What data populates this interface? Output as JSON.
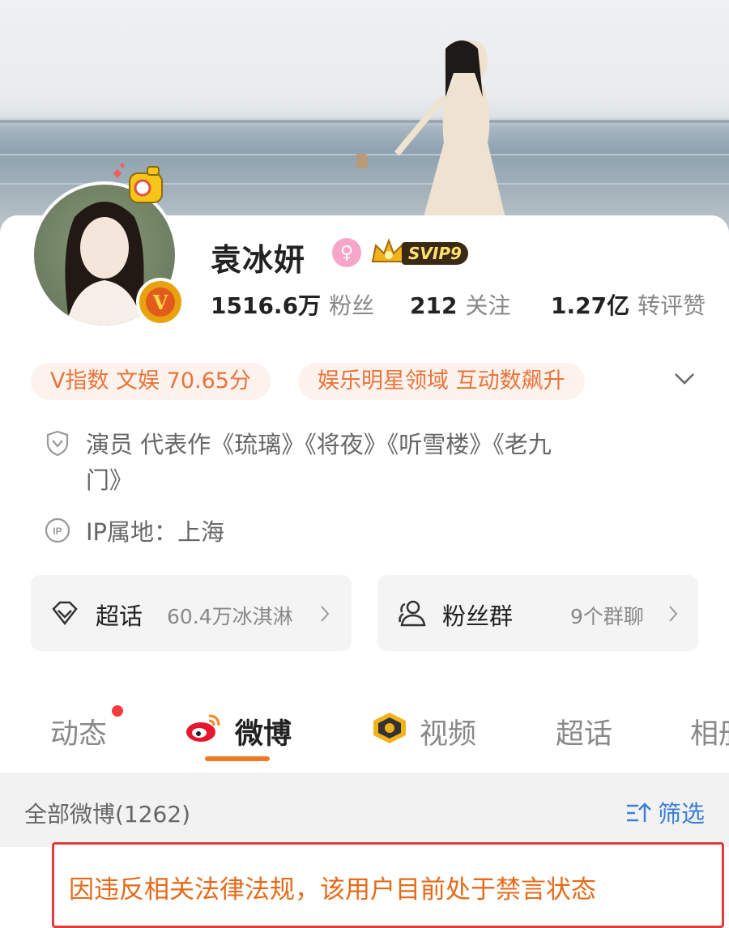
{
  "profile": {
    "name": "袁冰妍",
    "gender_icon": "female-icon",
    "vip_badge": "SVIP9",
    "verify_badge": "V"
  },
  "stats": {
    "fans_value": "1516.6万",
    "fans_label": "粉丝",
    "following_value": "212",
    "following_label": "关注",
    "likes_value": "1.27亿",
    "likes_label": "转评赞"
  },
  "pills": {
    "v_index": "V指数 文娱 70.65分",
    "field": "娱乐明星领域 互动数飙升"
  },
  "info": {
    "bio_line1": "演员 代表作《琉璃》《将夜》《听雪楼》《老九",
    "bio_line2": "门》",
    "ip": "IP属地：上海"
  },
  "boxes": {
    "topic_label": "超话",
    "topic_value": "60.4万冰淇淋",
    "group_label": "粉丝群",
    "group_value": "9个群聊"
  },
  "tabs": {
    "dynamics": "动态",
    "weibo": "微博",
    "video": "视频",
    "super_topic": "超话",
    "album": "相册"
  },
  "list": {
    "all_weibo": "全部微博(1262)",
    "filter": "筛选"
  },
  "notice": {
    "text": "因违反相关法律法规，该用户目前处于禁言状态"
  },
  "colors": {
    "accent_orange": "#f07a23",
    "filter_blue": "#3b7fd4",
    "notice_red": "#e23b3b"
  }
}
